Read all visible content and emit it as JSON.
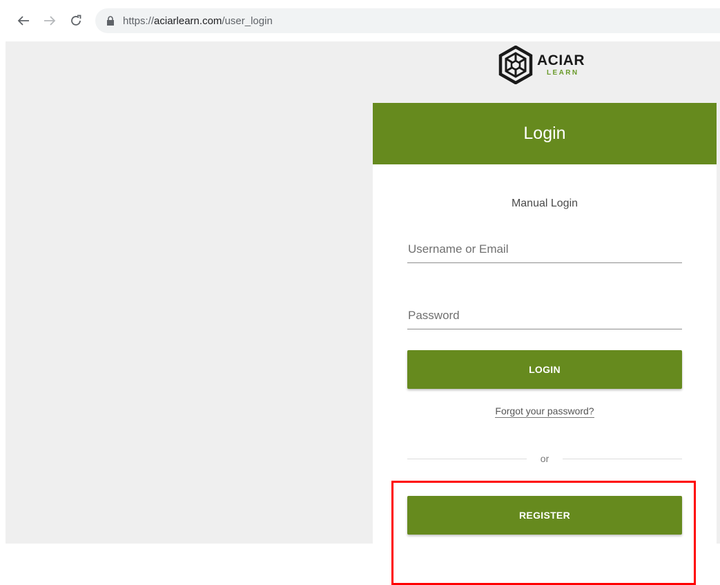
{
  "browser": {
    "url_scheme": "https://",
    "url_domain": "aciarlearn.com",
    "url_path": "/user_login",
    "icons": [
      "back-arrow-icon",
      "forward-arrow-icon",
      "reload-icon",
      "lock-icon"
    ]
  },
  "logo": {
    "title": "ACIAR",
    "subtitle": "LEARN"
  },
  "login_card": {
    "header_title": "Login",
    "section_title": "Manual Login",
    "username_placeholder": "Username or Email",
    "password_placeholder": "Password",
    "login_button": "LOGIN",
    "forgot_link": "Forgot your password?",
    "divider_text": "or",
    "register_button": "REGISTER"
  },
  "colors": {
    "brand_green": "#668a1e",
    "highlight_red": "#ff0000",
    "page_gray": "#efefef"
  }
}
